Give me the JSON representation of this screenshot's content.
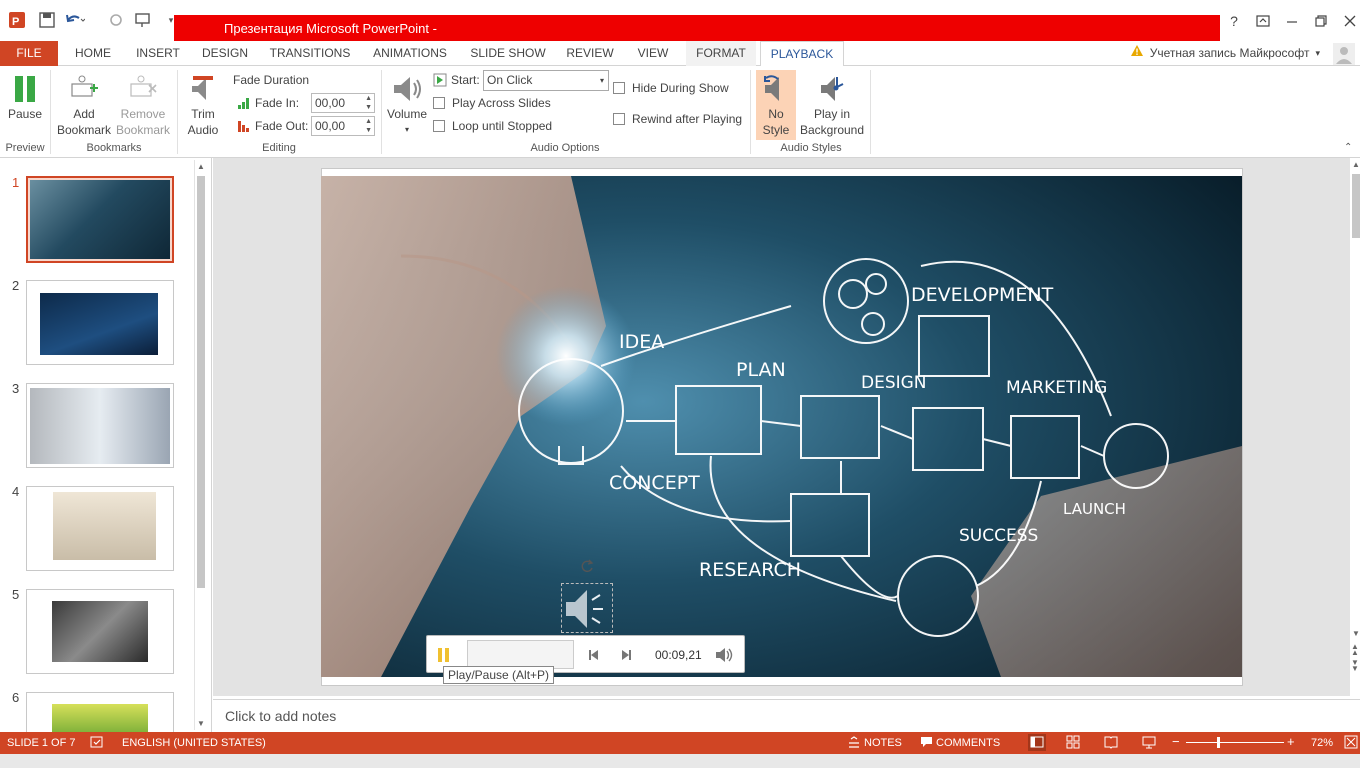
{
  "titlebar": {
    "title": "Презентация Microsoft PowerPoint -",
    "help": "?"
  },
  "tabs": [
    {
      "label": "FILE"
    },
    {
      "label": "HOME"
    },
    {
      "label": "INSERT"
    },
    {
      "label": "DESIGN"
    },
    {
      "label": "TRANSITIONS"
    },
    {
      "label": "ANIMATIONS"
    },
    {
      "label": "SLIDE SHOW"
    },
    {
      "label": "REVIEW"
    },
    {
      "label": "VIEW"
    },
    {
      "label": "FORMAT"
    },
    {
      "label": "PLAYBACK"
    }
  ],
  "account": "Учетная запись Майкрософт",
  "ribbon": {
    "preview": {
      "pause": "Pause",
      "label": "Preview"
    },
    "bookmarks": {
      "add": "Add Bookmark",
      "add_l1": "Add",
      "add_l2": "Bookmark",
      "remove_l1": "Remove",
      "remove_l2": "Bookmark",
      "label": "Bookmarks"
    },
    "editing": {
      "trim_l1": "Trim",
      "trim_l2": "Audio",
      "fade_duration": "Fade Duration",
      "fade_in": "Fade In:",
      "fade_in_value": "00,00",
      "fade_out": "Fade Out:",
      "fade_out_value": "00,00",
      "label": "Editing"
    },
    "audio_options": {
      "volume": "Volume",
      "start": "Start:",
      "start_value": "On Click",
      "play_across": "Play Across Slides",
      "loop": "Loop until Stopped",
      "hide": "Hide During Show",
      "rewind": "Rewind after Playing",
      "label": "Audio Options"
    },
    "audio_styles": {
      "no_style_l1": "No",
      "no_style_l2": "Style",
      "play_bg_l1": "Play in",
      "play_bg_l2": "Background",
      "label": "Audio Styles"
    }
  },
  "slides": [
    {
      "num": "1"
    },
    {
      "num": "2"
    },
    {
      "num": "3"
    },
    {
      "num": "4"
    },
    {
      "num": "5"
    },
    {
      "num": "6"
    }
  ],
  "slide_text": {
    "idea": "IDEA",
    "plan": "PLAN",
    "design": "DESIGN",
    "development": "DEVELOPMENT",
    "marketing": "MARKETING",
    "concept": "CONCEPT",
    "research": "RESEARCH",
    "success": "SUCCESS",
    "launch": "LAUNCH"
  },
  "player": {
    "time": "00:09,21",
    "tooltip": "Play/Pause (Alt+P)"
  },
  "notes_placeholder": "Click to add notes",
  "status": {
    "slide": "SLIDE 1 OF 7",
    "language": "ENGLISH (UNITED STATES)",
    "notes": "NOTES",
    "comments": "COMMENTS",
    "zoom": "72%"
  },
  "colors": {
    "accent": "#d04524",
    "title_red": "#ee0000",
    "selected_style": "#fcd3b6"
  }
}
